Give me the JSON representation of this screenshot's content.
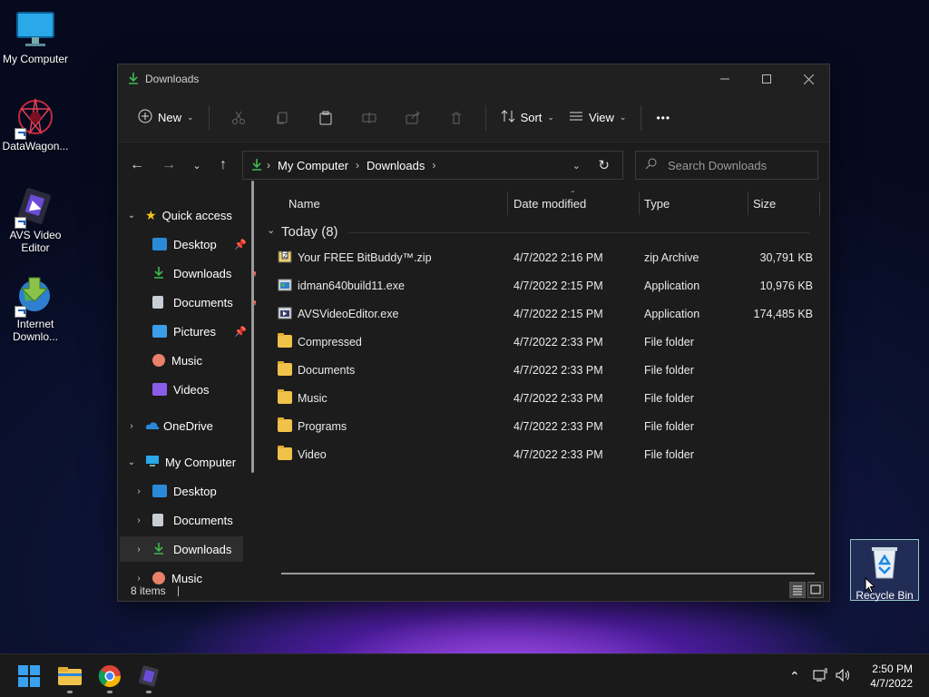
{
  "desktop": {
    "icons": [
      {
        "label": "My Computer"
      },
      {
        "label": "DataWagon..."
      },
      {
        "label": "AVS Video Editor"
      },
      {
        "label": "Internet Downlo..."
      },
      {
        "label": "Recycle Bin"
      }
    ]
  },
  "window": {
    "title": "Downloads",
    "toolbar": {
      "new_label": "New",
      "sort_label": "Sort",
      "view_label": "View",
      "more_label": "•••"
    },
    "breadcrumb": [
      "My Computer",
      "Downloads"
    ],
    "search_placeholder": "Search Downloads",
    "nav": {
      "quick_access": "Quick access",
      "quick_items": [
        "Desktop",
        "Downloads",
        "Documents",
        "Pictures",
        "Music",
        "Videos"
      ],
      "onedrive": "OneDrive",
      "my_computer": "My Computer",
      "computer_items": [
        "Desktop",
        "Documents",
        "Downloads",
        "Music"
      ]
    },
    "columns": {
      "name": "Name",
      "date": "Date modified",
      "type": "Type",
      "size": "Size"
    },
    "group_label": "Today (8)",
    "files": [
      {
        "name": "Your FREE BitBuddy™.zip",
        "date": "4/7/2022 2:16 PM",
        "type": "zip Archive",
        "size": "30,791 KB",
        "icon": "zip-icon"
      },
      {
        "name": "idman640build11.exe",
        "date": "4/7/2022 2:15 PM",
        "type": "Application",
        "size": "10,976 KB",
        "icon": "exe-icon"
      },
      {
        "name": "AVSVideoEditor.exe",
        "date": "4/7/2022 2:15 PM",
        "type": "Application",
        "size": "174,485 KB",
        "icon": "exe-icon"
      },
      {
        "name": "Compressed",
        "date": "4/7/2022 2:33 PM",
        "type": "File folder",
        "size": "",
        "icon": "folder-icon"
      },
      {
        "name": "Documents",
        "date": "4/7/2022 2:33 PM",
        "type": "File folder",
        "size": "",
        "icon": "folder-icon"
      },
      {
        "name": "Music",
        "date": "4/7/2022 2:33 PM",
        "type": "File folder",
        "size": "",
        "icon": "folder-icon"
      },
      {
        "name": "Programs",
        "date": "4/7/2022 2:33 PM",
        "type": "File folder",
        "size": "",
        "icon": "folder-icon"
      },
      {
        "name": "Video",
        "date": "4/7/2022 2:33 PM",
        "type": "File folder",
        "size": "",
        "icon": "folder-icon"
      }
    ],
    "status": "8 items"
  },
  "taskbar": {
    "time": "2:50 PM",
    "date": "4/7/2022"
  },
  "colors": {
    "accent_green": "#3fb950",
    "folder": "#f0c24c",
    "selected_nav": "#2d2d2d"
  }
}
